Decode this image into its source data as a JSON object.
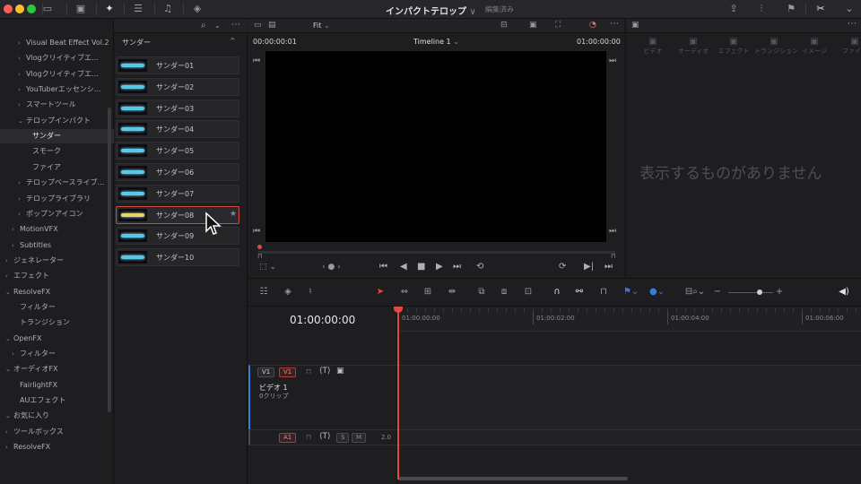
{
  "window": {
    "title": "インパクトテロップ",
    "title_chevron": "∨",
    "status": "編集済み"
  },
  "colors": {
    "close": "#ff5f57",
    "minimize": "#febc2e",
    "maximize": "#28c840",
    "accent": "#d0483f",
    "playhead": "#e5483f"
  },
  "left_panel": {
    "items": [
      {
        "label": "Visual Beat Effect Vol.2",
        "indent": 2,
        "chevron": "›"
      },
      {
        "label": "Vlogクリイティブエ...",
        "indent": 2,
        "chevron": "›"
      },
      {
        "label": "Vlogクリイティブエ...",
        "indent": 2,
        "chevron": "›"
      },
      {
        "label": "YouTuberエッセンシ...",
        "indent": 2,
        "chevron": "›"
      },
      {
        "label": "スマートツール",
        "indent": 2,
        "chevron": "›"
      },
      {
        "label": "テロップインパクト",
        "indent": 2,
        "chevron": "⌄"
      },
      {
        "label": "サンダー",
        "indent": 3,
        "chevron": "",
        "selected": true
      },
      {
        "label": "スモーク",
        "indent": 3,
        "chevron": ""
      },
      {
        "label": "ファイア",
        "indent": 3,
        "chevron": ""
      },
      {
        "label": "テロップベースライブ...",
        "indent": 2,
        "chevron": "›"
      },
      {
        "label": "テロップライブラリ",
        "indent": 2,
        "chevron": "›"
      },
      {
        "label": "ポップンアイコン",
        "indent": 2,
        "chevron": "›"
      },
      {
        "label": "MotionVFX",
        "indent": 1,
        "chevron": "›"
      },
      {
        "label": "Subtitles",
        "indent": 1,
        "chevron": "›"
      },
      {
        "label": "ジェネレーター",
        "indent": 0,
        "chevron": "›"
      },
      {
        "label": "エフェクト",
        "indent": 0,
        "chevron": "›"
      },
      {
        "label": "ResolveFX",
        "indent": 0,
        "chevron": "⌄"
      },
      {
        "label": "フィルター",
        "indent": 1,
        "chevron": ""
      },
      {
        "label": "トランジション",
        "indent": 1,
        "chevron": ""
      },
      {
        "label": "OpenFX",
        "indent": 0,
        "chevron": "⌄"
      },
      {
        "label": "フィルター",
        "indent": 1,
        "chevron": "›"
      },
      {
        "label": "オーディオFX",
        "indent": 0,
        "chevron": "⌄"
      },
      {
        "label": "FairlightFX",
        "indent": 1,
        "chevron": ""
      },
      {
        "label": "AUエフェクト",
        "indent": 1,
        "chevron": ""
      },
      {
        "label": "お気に入り",
        "indent": 0,
        "chevron": "⌄"
      },
      {
        "label": "ツールボックス",
        "indent": 0,
        "chevron": "›"
      },
      {
        "label": "ResolveFX",
        "indent": 0,
        "chevron": "›"
      }
    ]
  },
  "list_panel": {
    "header": "サンダー",
    "collapse_icon": "^",
    "items": [
      {
        "label": "サンダー01"
      },
      {
        "label": "サンダー02"
      },
      {
        "label": "サンダー03"
      },
      {
        "label": "サンダー04"
      },
      {
        "label": "サンダー05"
      },
      {
        "label": "サンダー06"
      },
      {
        "label": "サンダー07"
      },
      {
        "label": "サンダー08",
        "selected": true,
        "star": "★"
      },
      {
        "label": "サンダー09"
      },
      {
        "label": "サンダー10"
      }
    ]
  },
  "viewer": {
    "fit": "Fit",
    "timecode_left": "00:00:00:01",
    "timeline_name": "Timeline 1",
    "timecode_right": "01:00:00:00"
  },
  "inspector": {
    "tabs": [
      "ビデオ",
      "オーディオ",
      "エフェクト",
      "トランジション",
      "イメージ",
      "ファイル"
    ],
    "empty_message": "表示するものがありません"
  },
  "timeline": {
    "timecode": "01:00:00:00",
    "ruler": [
      "01:00:00:00",
      "01:00:02:00",
      "01:00:04:00",
      "01:00:06:00"
    ],
    "video_track": {
      "tag": "V1",
      "dest": "V1",
      "name": "ビデオ 1",
      "clips": "0クリップ"
    },
    "audio_track": {
      "tag": "A1",
      "s": "S",
      "m": "M",
      "level": "2.0"
    }
  }
}
